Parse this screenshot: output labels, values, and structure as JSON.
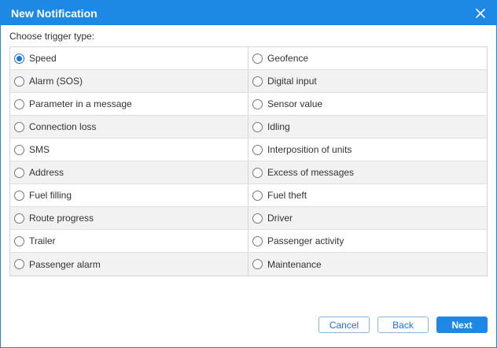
{
  "dialog": {
    "title": "New Notification",
    "prompt": "Choose trigger type:",
    "selected": "Speed",
    "options": [
      {
        "left": "Speed",
        "right": "Geofence"
      },
      {
        "left": "Alarm (SOS)",
        "right": "Digital input"
      },
      {
        "left": "Parameter in a message",
        "right": "Sensor value"
      },
      {
        "left": "Connection loss",
        "right": "Idling"
      },
      {
        "left": "SMS",
        "right": "Interposition of units"
      },
      {
        "left": "Address",
        "right": "Excess of messages"
      },
      {
        "left": "Fuel filling",
        "right": "Fuel theft"
      },
      {
        "left": "Route progress",
        "right": "Driver"
      },
      {
        "left": "Trailer",
        "right": "Passenger activity"
      },
      {
        "left": "Passenger alarm",
        "right": "Maintenance"
      }
    ]
  },
  "buttons": {
    "cancel": "Cancel",
    "back": "Back",
    "next": "Next"
  },
  "colors": {
    "accent": "#1e88e5",
    "radio_checked": "#1e6fd9",
    "row_alt": "#f2f2f2"
  },
  "icons": {
    "close": "close-icon"
  }
}
